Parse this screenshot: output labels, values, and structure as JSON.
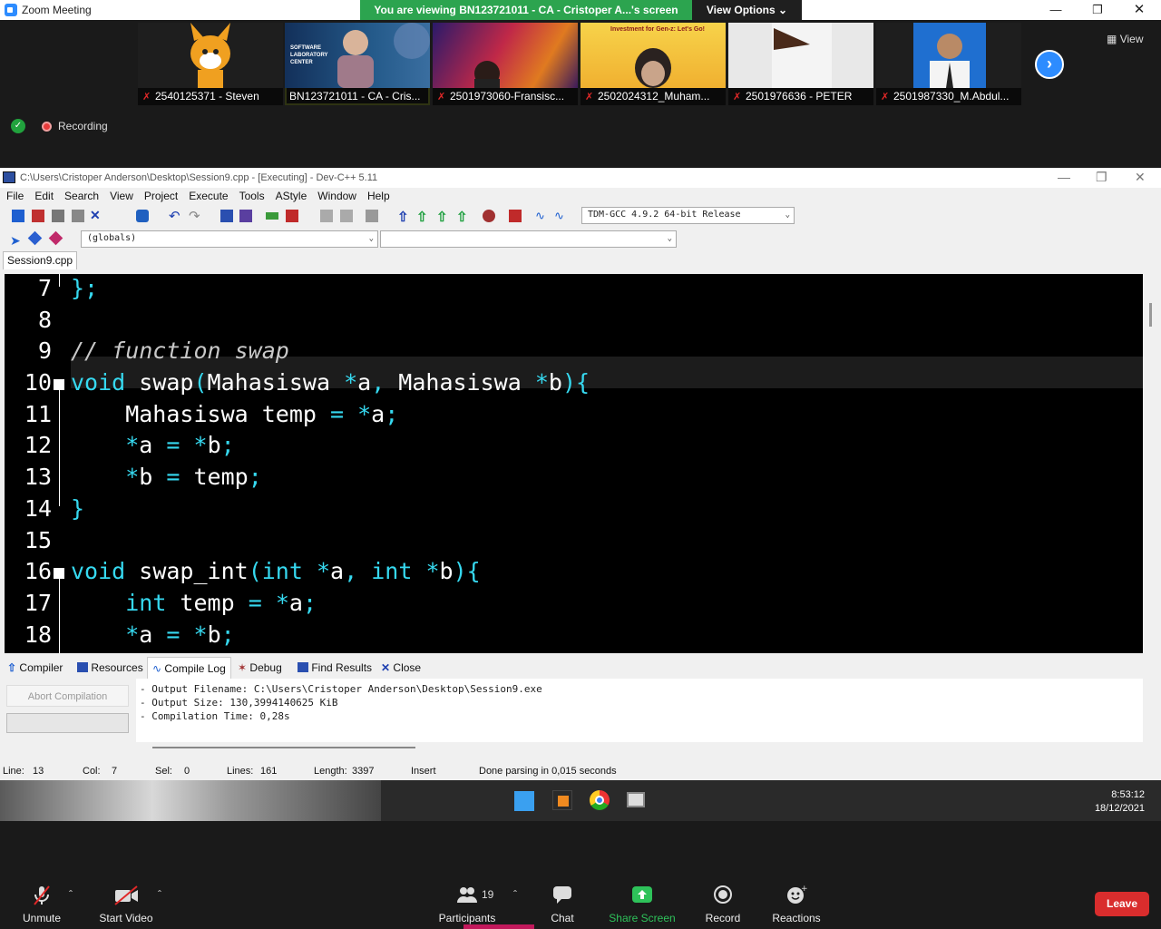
{
  "zoom": {
    "title": "Zoom Meeting",
    "share_banner": "You are viewing BN123721011 - CA - Cristoper A...'s screen",
    "view_options": "View Options",
    "view_label": "View",
    "recording_label": "Recording",
    "participants": [
      {
        "name": "2540125371 - Steven"
      },
      {
        "name": "BN123721011 - CA - Cris..."
      },
      {
        "name": "2501973060-Fransisc..."
      },
      {
        "name": "2502024312_Muham..."
      },
      {
        "name": "2501976636 - PETER"
      },
      {
        "name": "2501987330_M.Abdul..."
      }
    ],
    "tile_overlays": {
      "sw_lab": "SOFTWARE LABORATORY CENTER",
      "investment": "Investment for Gen-z: Let's Go!"
    },
    "controls": {
      "unmute": "Unmute",
      "start_video": "Start Video",
      "participants": "Participants",
      "participants_count": "19",
      "chat": "Chat",
      "share_screen": "Share Screen",
      "record": "Record",
      "reactions": "Reactions",
      "leave": "Leave"
    }
  },
  "devcpp": {
    "title": "C:\\Users\\Cristoper Anderson\\Desktop\\Session9.cpp - [Executing] - Dev-C++ 5.11",
    "menu": [
      "File",
      "Edit",
      "Search",
      "View",
      "Project",
      "Execute",
      "Tools",
      "AStyle",
      "Window",
      "Help"
    ],
    "compiler_select": "TDM-GCC 4.9.2 64-bit Release",
    "scope_select": "(globals)",
    "file_tab": "Session9.cpp",
    "line_numbers": [
      "7",
      "8",
      "9",
      "10",
      "11",
      "12",
      "13",
      "14",
      "15",
      "16",
      "17",
      "18"
    ],
    "bottom_tabs": [
      "Compiler",
      "Resources",
      "Compile Log",
      "Debug",
      "Find Results",
      "Close"
    ],
    "abort_label": "Abort Compilation",
    "log_lines": [
      "- Output Filename: C:\\Users\\Cristoper Anderson\\Desktop\\Session9.exe",
      "- Output Size: 130,3994140625 KiB",
      "- Compilation Time: 0,28s"
    ],
    "status": {
      "line_label": "Line:",
      "line_value": "13",
      "col_label": "Col:",
      "col_value": "7",
      "sel_label": "Sel:",
      "sel_value": "0",
      "lines_label": "Lines:",
      "lines_value": "161",
      "length_label": "Length:",
      "length_value": "3397",
      "mode": "Insert",
      "parse_msg": "Done parsing in 0,015 seconds"
    }
  },
  "taskbar": {
    "time": "8:53:12",
    "date": "18/12/2021"
  }
}
